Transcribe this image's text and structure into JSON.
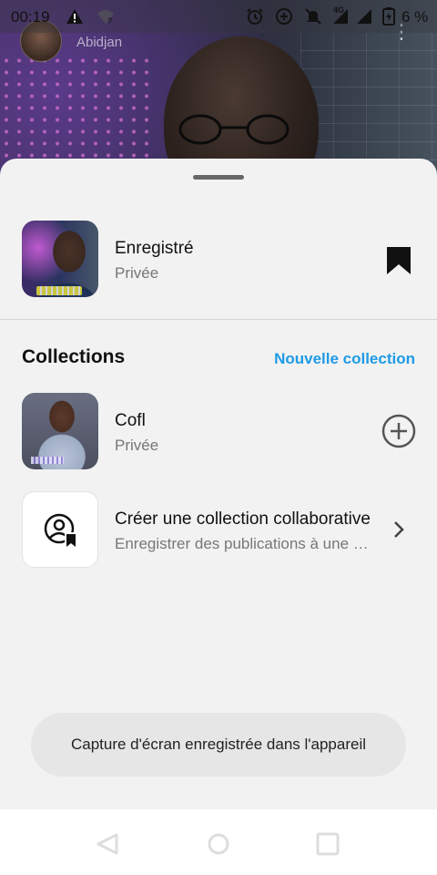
{
  "status_bar": {
    "time": "00:19",
    "network_label": "4G",
    "battery_percent": "6 %",
    "icons": [
      "warning-icon",
      "wifi-question-icon",
      "alarm-icon",
      "data-saver-icon",
      "mute-icon",
      "signal-icon",
      "signal-icon",
      "battery-charging-icon"
    ]
  },
  "background_post": {
    "location": "Abidjan"
  },
  "sheet": {
    "saved": {
      "title": "Enregistré",
      "visibility": "Privée",
      "icon": "bookmark-filled-icon"
    },
    "collections_header": {
      "title": "Collections",
      "new_collection_label": "Nouvelle collection"
    },
    "collections": [
      {
        "title": "Cofl",
        "visibility": "Privée",
        "action_icon": "add-circle-icon"
      }
    ],
    "collaborative": {
      "title": "Créer une collection collaborative",
      "subtitle": "Enregistrer des publications à une collection partagée",
      "icon": "person-bookmark-icon",
      "action_icon": "chevron-right-icon"
    }
  },
  "toast": {
    "message": "Capture d'écran enregistrée dans l'appareil"
  },
  "nav_bar": {
    "buttons": [
      "back-icon",
      "home-icon",
      "recents-icon"
    ]
  },
  "colors": {
    "accent": "#1e9be6",
    "sheet_background": "#f2f2f2",
    "text_primary": "#111111",
    "text_secondary": "#777777"
  }
}
